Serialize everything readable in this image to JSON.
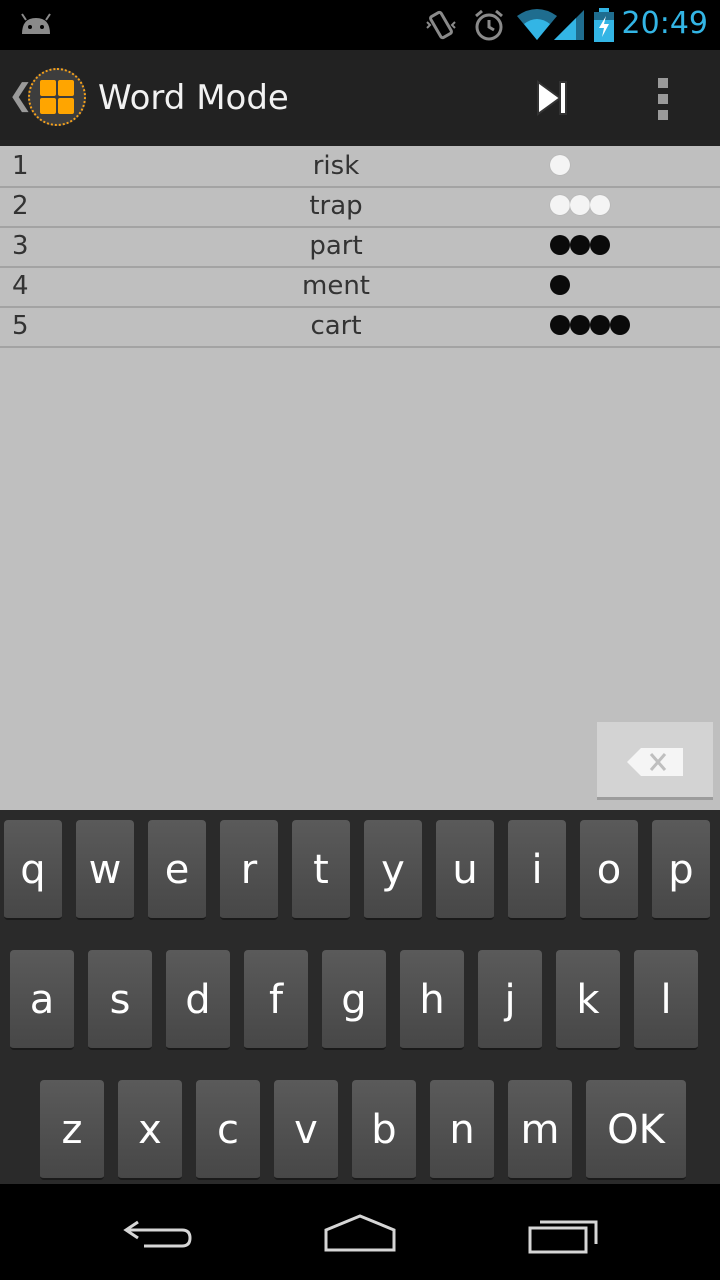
{
  "status_bar": {
    "time": "20:49",
    "icons": [
      "android-notification-icon",
      "vibrate-icon",
      "alarm-icon",
      "wifi-icon",
      "signal-icon",
      "battery-charging-icon"
    ]
  },
  "action_bar": {
    "title": "Word Mode",
    "icons": [
      "up-caret-icon",
      "app-grid-icon",
      "skip-next-icon",
      "overflow-menu-icon"
    ]
  },
  "rows": [
    {
      "num": "1",
      "word": "risk",
      "dots": [
        "white"
      ]
    },
    {
      "num": "2",
      "word": "trap",
      "dots": [
        "white",
        "white",
        "white"
      ]
    },
    {
      "num": "3",
      "word": "part",
      "dots": [
        "black",
        "black",
        "black"
      ]
    },
    {
      "num": "4",
      "word": "ment",
      "dots": [
        "black"
      ]
    },
    {
      "num": "5",
      "word": "cart",
      "dots": [
        "black",
        "black",
        "black",
        "black"
      ]
    }
  ],
  "keyboard": {
    "row1": [
      "q",
      "w",
      "e",
      "r",
      "t",
      "y",
      "u",
      "i",
      "o",
      "p"
    ],
    "row2": [
      "a",
      "s",
      "d",
      "f",
      "g",
      "h",
      "j",
      "k",
      "l"
    ],
    "row3": [
      "z",
      "x",
      "c",
      "v",
      "b",
      "n",
      "m"
    ],
    "ok_label": "OK"
  },
  "nav_bar": {
    "icons": [
      "back-icon",
      "home-icon",
      "recent-apps-icon"
    ]
  },
  "colors": {
    "clock": "#33b5e5",
    "accent": "#ffa500",
    "content_bg": "#bfbfbf"
  }
}
